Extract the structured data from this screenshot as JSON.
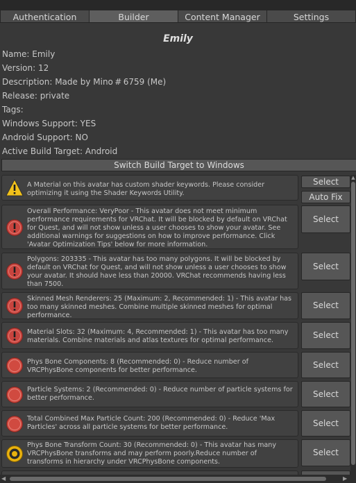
{
  "tabs": [
    "Authentication",
    "Builder",
    "Content Manager",
    "Settings"
  ],
  "active_tab": "Builder",
  "avatar": {
    "title": "Emily",
    "name_line": "Name: Emily",
    "version_line": "Version: 12",
    "description_line": "Description: Made by Mino # 6759   (Me)",
    "release_line": "Release: private",
    "tags_line": "Tags:",
    "windows_line": "Windows Support: YES",
    "android_line": "Android Support: NO",
    "target_line": "Active Build Target: Android"
  },
  "switch_button": "Switch Build Target to Windows",
  "validation_items": [
    {
      "severity": "warning",
      "icon": "warning-triangle-icon",
      "text": "A Material on this avatar has custom shader keywords. Please consider optimizing it using the Shader Keywords Utility.",
      "buttons": [
        "Select",
        "Auto Fix"
      ]
    },
    {
      "severity": "very-poor",
      "icon": "very-poor-rating-icon",
      "text": "Overall Performance: VeryPoor - This avatar does not meet minimum performance requirements for VRChat. It will be blocked by default on VRChat for Quest, and will not show unless a user chooses to show your avatar. See additional warnings for suggestions on how to improve performance. Click 'Avatar Optimization Tips' below for more information.",
      "buttons": [
        "Select"
      ]
    },
    {
      "severity": "very-poor",
      "icon": "very-poor-rating-icon",
      "text": "Polygons: 203335 - This avatar has too many polygons. It will be blocked by default on VRChat for Quest, and will not show unless a user chooses to show your avatar. It should have less than 20000. VRChat recommends having less than 7500.",
      "buttons": [
        "Select"
      ]
    },
    {
      "severity": "very-poor",
      "icon": "very-poor-rating-icon",
      "text": "Skinned Mesh Renderers: 25 (Maximum: 2, Recommended: 1) - This avatar has too many skinned meshes. Combine multiple skinned meshes for optimal performance.",
      "buttons": [
        "Select"
      ]
    },
    {
      "severity": "very-poor",
      "icon": "very-poor-rating-icon",
      "text": "Material Slots: 32 (Maximum: 4, Recommended: 1) - This avatar has too many materials. Combine materials and atlas textures for optimal performance.",
      "buttons": [
        "Select"
      ]
    },
    {
      "severity": "poor",
      "icon": "poor-rating-icon",
      "text": "Phys Bone Components: 8 (Recommended: 0) - Reduce number of VRCPhysBone components for better performance.",
      "buttons": [
        "Select"
      ]
    },
    {
      "severity": "poor",
      "icon": "poor-rating-icon",
      "text": "Particle Systems: 2 (Recommended: 0) - Reduce number of particle systems for better performance.",
      "buttons": [
        "Select"
      ]
    },
    {
      "severity": "poor",
      "icon": "poor-rating-icon",
      "text": "Total Combined Max Particle Count: 200 (Recommended: 0) - Reduce 'Max Particles' across all particle systems for better performance.",
      "buttons": [
        "Select"
      ]
    },
    {
      "severity": "medium",
      "icon": "medium-rating-icon",
      "text": "Phys Bone Transform Count: 30 (Recommended: 0) - This avatar has many VRCPhysBone transforms and may perform poorly.Reduce number of transforms in hierarchy under VRCPhysBone components.",
      "buttons": [
        "Select"
      ]
    }
  ],
  "colors": {
    "background": "#383838",
    "very_poor": "#c8443e",
    "poor": "#d04a40",
    "medium": "#e8b10e",
    "warning": "#f2c21b"
  }
}
